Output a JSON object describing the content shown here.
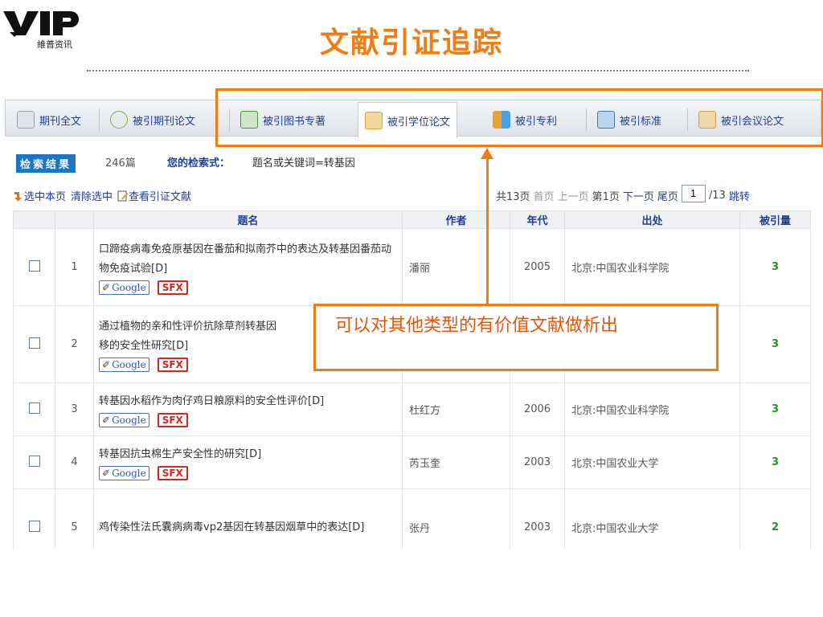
{
  "brand": {
    "logo_letters": "VIP",
    "logo_text": "維普资讯"
  },
  "page_title": "文献引证追踪",
  "tabs": [
    {
      "label": "期刊全文",
      "icon": "document-icon",
      "color": "#c9ced8"
    },
    {
      "label": "被引期刊论文",
      "icon": "check-disc-icon",
      "color": "#7bb04a"
    },
    {
      "label": "被引图书专著",
      "icon": "open-book-icon",
      "color": "#4a9a3a"
    },
    {
      "label": "被引学位论文",
      "icon": "graduate-icon",
      "color": "#e0a040",
      "active": true
    },
    {
      "label": "被引专利",
      "icon": "patent-blocks-icon",
      "color": "#e8a238"
    },
    {
      "label": "被引标准",
      "icon": "standard-check-icon",
      "color": "#3c7ac0"
    },
    {
      "label": "被引会议论文",
      "icon": "conference-icon",
      "color": "#d4a050"
    }
  ],
  "search": {
    "result_label": "检索结果",
    "result_count": "246篇",
    "query_label": "您的检索式：",
    "query_value": "题名或关键词=转基因"
  },
  "toolbar": {
    "select_page": "选中本页",
    "clear_selection": "清除选中",
    "view_citations": "查看引证文献"
  },
  "pager": {
    "total": "共13页",
    "first": "首页",
    "prev": "上一页",
    "current": "第1页",
    "next": "下一页",
    "last": "尾页",
    "input_value": "1",
    "of_total": "/13",
    "jump": "跳转"
  },
  "table": {
    "columns": [
      "题名",
      "作者",
      "年代",
      "出处",
      "被引量"
    ],
    "rows": [
      {
        "num": "1",
        "title": "口蹄疫病毒免疫原基因在番茄和拟南芥中的表达及转基因番茄动物免疫试验[D]",
        "author": "潘丽",
        "year": "2005",
        "source": "北京:中国农业科学院",
        "cited": "3"
      },
      {
        "num": "2",
        "title": "通过植物的亲和性评价抗除草剂转基因",
        "title_line2": "移的安全性研究[D]",
        "author": "",
        "year": "",
        "source": "",
        "cited": "3"
      },
      {
        "num": "3",
        "title": "转基因水稻作为肉仔鸡日粮原料的安全性评价[D]",
        "author": "杜红方",
        "year": "2006",
        "source": "北京:中国农业科学院",
        "cited": "3"
      },
      {
        "num": "4",
        "title": "转基因抗虫棉生产安全性的研究[D]",
        "author": "芮玉奎",
        "year": "2003",
        "source": "北京:中国农业大学",
        "cited": "3"
      },
      {
        "num": "5",
        "title": "鸡传染性法氏囊病病毒vp2基因在转基因烟草中的表达[D]",
        "author": "张丹",
        "year": "2003",
        "source": "北京:中国农业大学",
        "cited": "2"
      }
    ],
    "badge_google": "Google",
    "badge_sfx": "SFX"
  },
  "callout": {
    "text": "可以对其他类型的有价值文献做析出"
  },
  "colors": {
    "accent": "#f07d14",
    "link": "#1f3f9a",
    "cited": "#1a9a1a",
    "sfx": "#d6261f"
  }
}
